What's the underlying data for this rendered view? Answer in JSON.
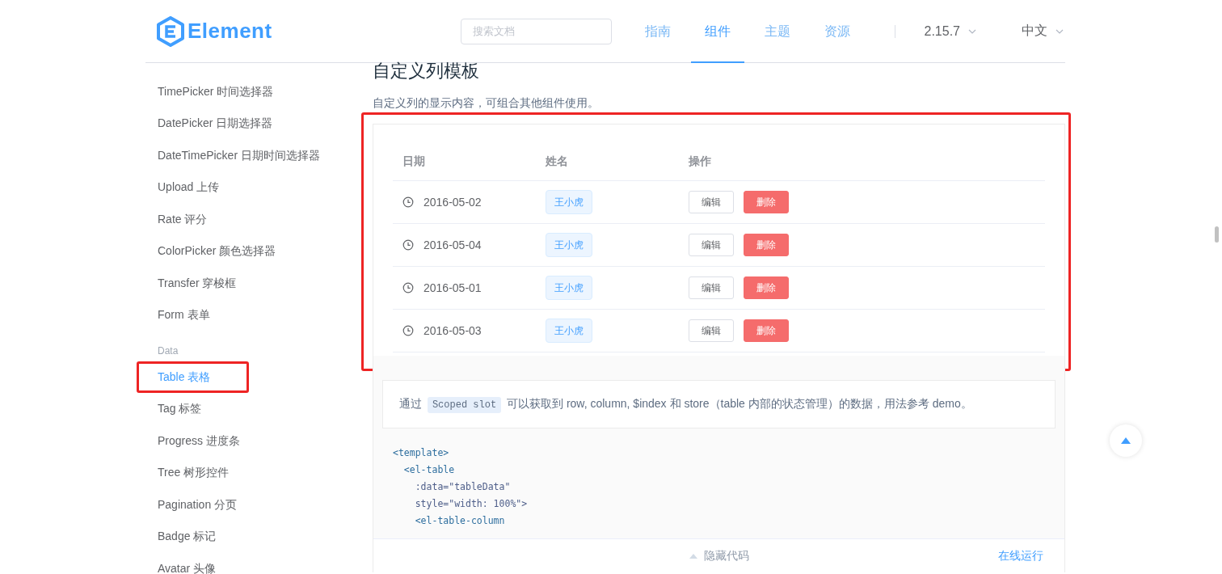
{
  "header": {
    "logo": "Element",
    "search": {
      "placeholder": "搜索文档"
    },
    "nav": [
      {
        "label": "指南",
        "selected": false
      },
      {
        "label": "组件",
        "selected": true
      },
      {
        "label": "主题",
        "selected": false
      },
      {
        "label": "资源",
        "selected": false
      }
    ],
    "version": "2.15.7",
    "language": "中文"
  },
  "sidebar": {
    "sections": [
      {
        "items": [
          {
            "label": "TimePicker 时间选择器",
            "selected": false,
            "annotated": false
          },
          {
            "label": "DatePicker 日期选择器",
            "selected": false,
            "annotated": false
          },
          {
            "label": "DateTimePicker 日期时间选择器",
            "selected": false,
            "annotated": false
          },
          {
            "label": "Upload 上传",
            "selected": false,
            "annotated": false
          },
          {
            "label": "Rate 评分",
            "selected": false,
            "annotated": false
          },
          {
            "label": "ColorPicker 颜色选择器",
            "selected": false,
            "annotated": false
          },
          {
            "label": "Transfer 穿梭框",
            "selected": false,
            "annotated": false
          },
          {
            "label": "Form 表单",
            "selected": false,
            "annotated": false
          }
        ]
      },
      {
        "heading": "Data",
        "items": [
          {
            "label": "Table 表格",
            "selected": true,
            "annotated": true
          },
          {
            "label": "Tag 标签",
            "selected": false,
            "annotated": false
          },
          {
            "label": "Progress 进度条",
            "selected": false,
            "annotated": false
          },
          {
            "label": "Tree 树形控件",
            "selected": false,
            "annotated": false
          },
          {
            "label": "Pagination 分页",
            "selected": false,
            "annotated": false
          },
          {
            "label": "Badge 标记",
            "selected": false,
            "annotated": false
          },
          {
            "label": "Avatar 头像",
            "selected": false,
            "annotated": false
          }
        ]
      }
    ]
  },
  "content": {
    "title": "自定义列模板",
    "description": "自定义列的显示内容，可组合其他组件使用。",
    "demo": {
      "annotated": true,
      "columns": [
        "日期",
        "姓名",
        "操作"
      ],
      "rows": [
        {
          "date": "2016-05-02",
          "name": "王小虎",
          "actions": [
            {
              "label": "编辑",
              "kind": "default"
            },
            {
              "label": "删除",
              "kind": "danger"
            }
          ]
        },
        {
          "date": "2016-05-04",
          "name": "王小虎",
          "actions": [
            {
              "label": "编辑",
              "kind": "default"
            },
            {
              "label": "删除",
              "kind": "danger"
            }
          ]
        },
        {
          "date": "2016-05-01",
          "name": "王小虎",
          "actions": [
            {
              "label": "编辑",
              "kind": "default"
            },
            {
              "label": "删除",
              "kind": "danger"
            }
          ]
        },
        {
          "date": "2016-05-03",
          "name": "王小虎",
          "actions": [
            {
              "label": "编辑",
              "kind": "default"
            },
            {
              "label": "删除",
              "kind": "danger"
            }
          ]
        }
      ]
    },
    "note": {
      "before": "通过",
      "code": "Scoped slot",
      "after": "可以获取到 row, column, $index 和 store（table 内部的状态管理）的数据，用法参考 demo。"
    },
    "code_lines": [
      {
        "text": "<template>",
        "kind": "tag"
      },
      {
        "text": "  <el-table",
        "kind": "tag"
      },
      {
        "text": "    :data=\"tableData\"",
        "kind": "attr"
      },
      {
        "text": "    style=\"width: 100%\">",
        "kind": "attr"
      },
      {
        "text": "    <el-table-column",
        "kind": "tag"
      }
    ],
    "footer": {
      "toggle": "隐藏代码",
      "run": "在线运行"
    }
  }
}
